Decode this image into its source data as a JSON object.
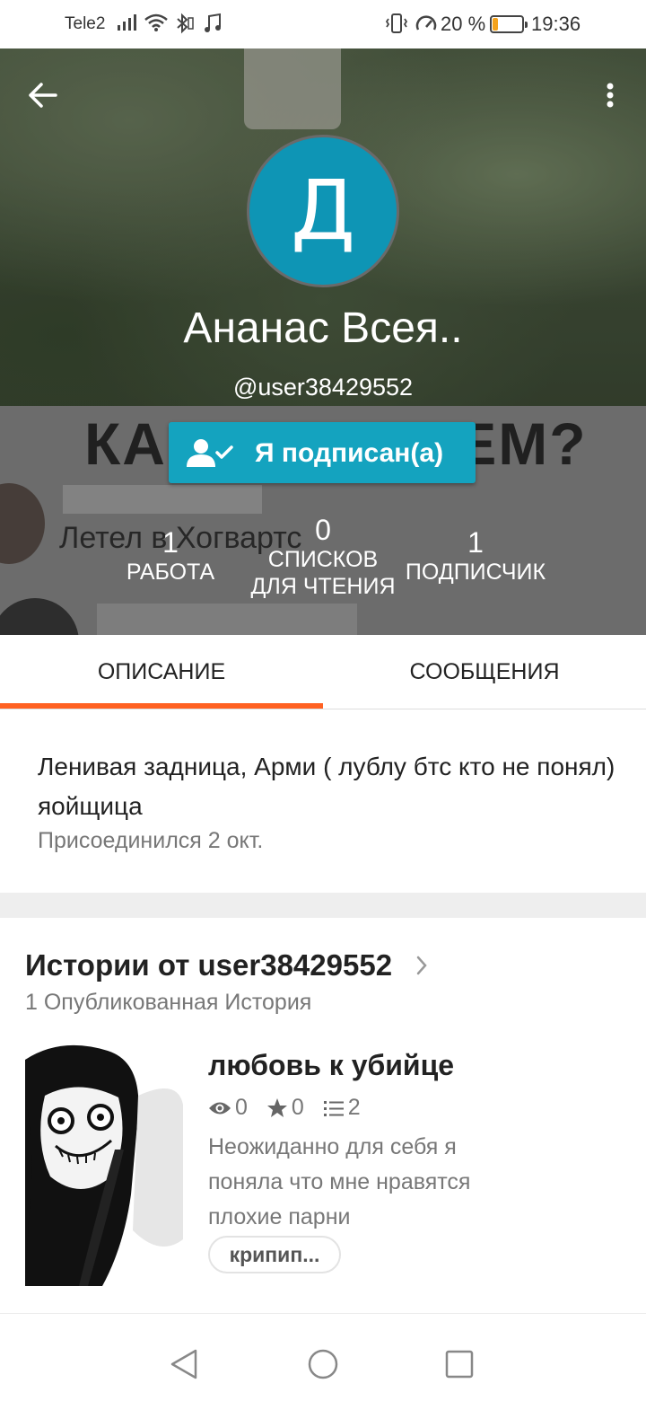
{
  "status_bar": {
    "carrier": "Tele2",
    "battery": "20 %",
    "battery_level": 0.2,
    "time": "19:36",
    "battery_color": "#f4a21b"
  },
  "header": {
    "avatar_letter": "Д",
    "avatar_color": "#0e95b5",
    "display_name": "Ананас Всея..",
    "username": "@user38429552",
    "follow_label": "Я подписан(а)",
    "follow_color": "#14a3bf",
    "background_card": {
      "title": "КАК Я СПИТЕМ?",
      "text": "Летел в Хогвартс"
    },
    "stats": {
      "works": {
        "value": "1",
        "label": "РАБОТА"
      },
      "reading_lists": {
        "value": "0",
        "label_line1": "СПИСКОВ",
        "label_line2": "ДЛЯ ЧТЕНИЯ"
      },
      "followers": {
        "value": "1",
        "label": "ПОДПИСЧИК"
      }
    }
  },
  "tabs": [
    {
      "label": "ОПИСАНИЕ",
      "active": true
    },
    {
      "label": "СООБЩЕНИЯ",
      "active": false
    }
  ],
  "accent_color": "#ff6122",
  "about": {
    "text": "Ленивая задница, Арми ( лублу бтс кто не понял) яойщица",
    "joined": "Присоединился 2 окт."
  },
  "stories": {
    "title": "Истории от user38429552",
    "count": "1 Опубликованная История",
    "items": [
      {
        "title": "любовь к убийце",
        "views": "0",
        "votes": "0",
        "parts": "2",
        "description": "Неожиданно для себя я поняла что мне нравятся плохие парни",
        "tag": "крипип..."
      }
    ]
  },
  "icons": {
    "back": "arrow-left-icon",
    "more": "more-vertical-icon",
    "follow": "user-check-icon",
    "views": "eye-icon",
    "votes": "star-icon",
    "parts": "list-icon",
    "chevron": "chevron-right-icon"
  }
}
